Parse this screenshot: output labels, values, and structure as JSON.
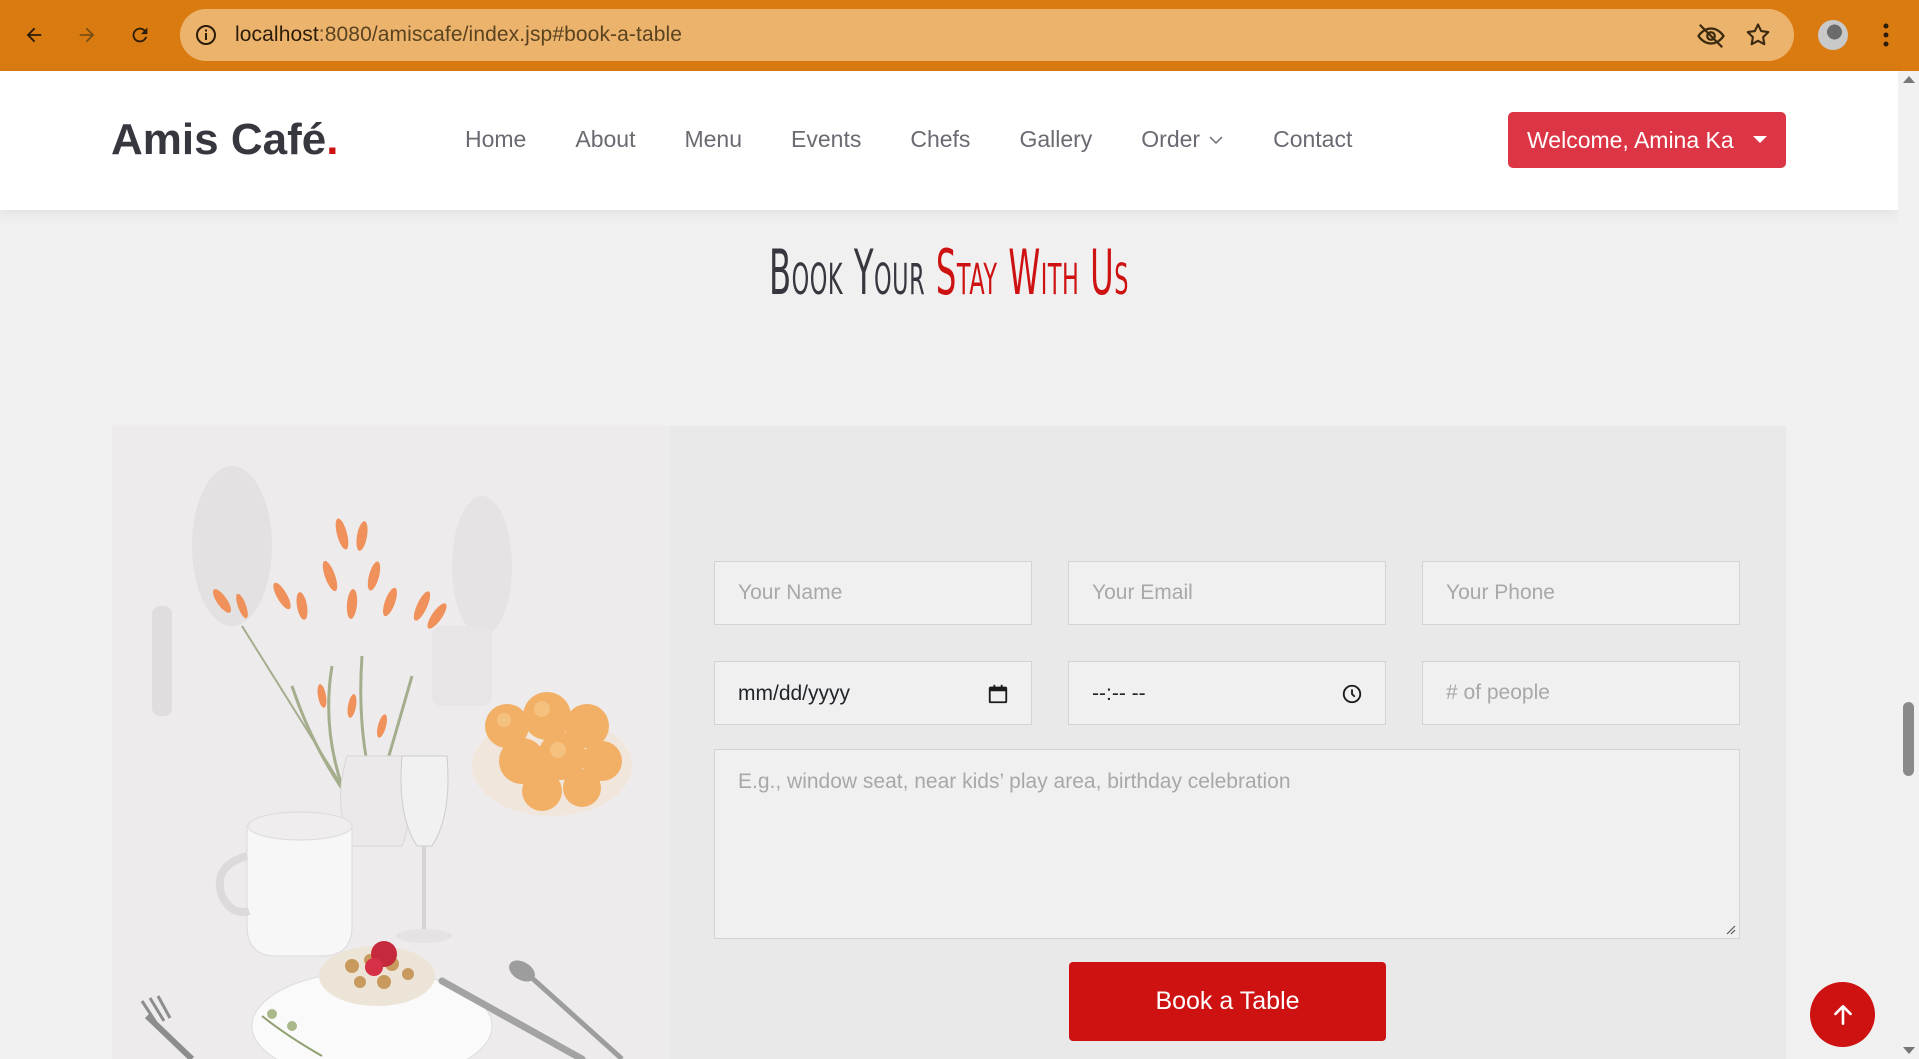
{
  "browser": {
    "url_host": "localhost",
    "url_path": ":8080/amiscafe/index.jsp#book-a-table",
    "icons": [
      "back-icon",
      "forward-icon",
      "reload-icon",
      "info-icon",
      "eye-off-icon",
      "star-icon",
      "profile-avatar",
      "kebab-menu-icon"
    ]
  },
  "header": {
    "logo_text": "Amis Café",
    "logo_dot": ".",
    "menu": [
      {
        "label": "Home"
      },
      {
        "label": "About"
      },
      {
        "label": "Menu"
      },
      {
        "label": "Events"
      },
      {
        "label": "Chefs"
      },
      {
        "label": "Gallery"
      },
      {
        "label": "Order"
      },
      {
        "label": "Contact"
      }
    ],
    "welcome_label": "Welcome, Amina Ka"
  },
  "section": {
    "title_main": "Book Your ",
    "title_accent": "Stay With Us"
  },
  "form": {
    "name_placeholder": "Your Name",
    "email_placeholder": "Your Email",
    "phone_placeholder": "Your Phone",
    "date_value": "mm/dd/yyyy",
    "time_value": "--:-- --",
    "people_placeholder": "# of people",
    "message_placeholder": "E.g., window seat, near kids’ play area, birthday celebration",
    "submit_label": "Book a Table"
  },
  "colors": {
    "browser_bar": "#da7b12",
    "accent": "#ce1212",
    "welcome_button": "#dc3545"
  }
}
